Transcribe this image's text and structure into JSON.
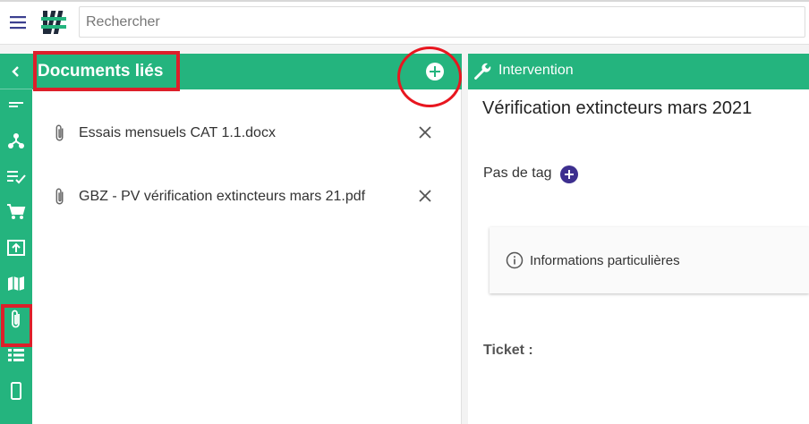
{
  "topbar": {
    "search_placeholder": "Rechercher",
    "menu_icon": "hamburger-menu-icon",
    "logo": "app-logo"
  },
  "rail": {
    "items": [
      {
        "icon": "chevron-left-icon"
      },
      {
        "icon": "short-text-icon"
      },
      {
        "icon": "hierarchy-icon"
      },
      {
        "icon": "checklist-icon"
      },
      {
        "icon": "cart-icon"
      },
      {
        "icon": "upload-box-icon"
      },
      {
        "icon": "map-icon"
      },
      {
        "icon": "paperclip-icon",
        "active": true
      },
      {
        "icon": "list-icon"
      },
      {
        "icon": "phone-icon"
      }
    ]
  },
  "documents": {
    "title": "Documents liés",
    "items": [
      {
        "name": "Essais mensuels CAT 1.1.docx"
      },
      {
        "name": "GBZ - PV vérification extincteurs mars 21.pdf"
      }
    ]
  },
  "intervention": {
    "header": "Intervention",
    "title": "Vérification extincteurs mars 2021",
    "tag_label": "Pas de tag",
    "info_label": "Informations particulières",
    "ticket_label": "Ticket :"
  },
  "colors": {
    "accent": "#24b47e",
    "highlight": "#dd1f2a",
    "tag_button": "#3d2f8f"
  }
}
